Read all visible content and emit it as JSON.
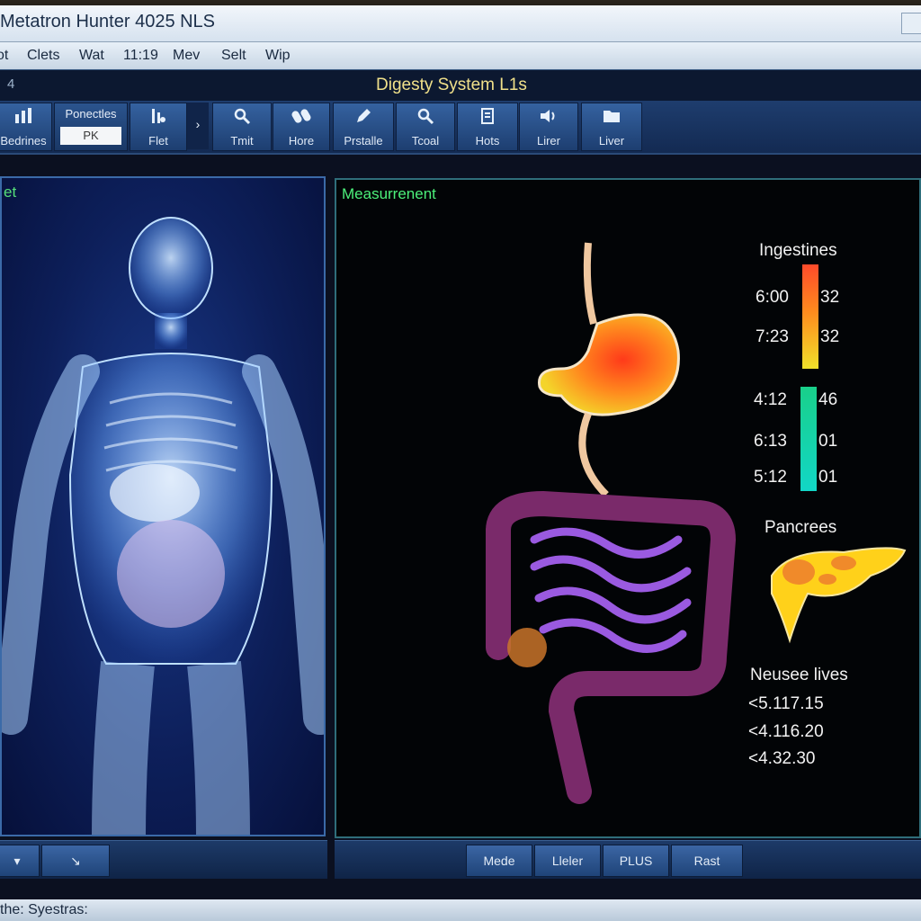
{
  "window": {
    "title": "Metatron Hunter 4025 NLS"
  },
  "menu": [
    "ot",
    "Clets",
    "Wat",
    "11:19",
    "Mev",
    "Selt",
    "Wip"
  ],
  "status": {
    "left": "4",
    "center": "Digesty System L1s"
  },
  "toolbar": {
    "left_tool": {
      "icon": "chart-icon",
      "label": "Bedrines"
    },
    "combo": {
      "label": "Ponectles",
      "value": "PK"
    },
    "tools": [
      {
        "icon": "filter-icon",
        "label": "Flet"
      },
      {
        "icon": "search-gear-icon",
        "label": "Tmit"
      },
      {
        "icon": "pills-icon",
        "label": "Hore"
      },
      {
        "icon": "pencil-icon",
        "label": "Prstalle"
      },
      {
        "icon": "search-icon",
        "label": "Tcoal"
      },
      {
        "icon": "document-icon",
        "label": "Hots"
      },
      {
        "icon": "speaker-icon",
        "label": "Lirer"
      },
      {
        "icon": "folder-icon",
        "label": "Liver"
      }
    ]
  },
  "left_panel": {
    "label": "et"
  },
  "right_panel": {
    "label": "Measurrenent",
    "legend1": {
      "title": "Ingestines",
      "rows": [
        {
          "time": "6:00",
          "value": "32"
        },
        {
          "time": "7:23",
          "value": "32"
        }
      ]
    },
    "legend2": {
      "rows": [
        {
          "time": "4:12",
          "value": "46"
        },
        {
          "time": "6:13",
          "value": "01"
        },
        {
          "time": "5:12",
          "value": "01"
        }
      ]
    },
    "organ_label": "Pancrees",
    "values_title": "Neusee lives",
    "values": [
      "<5.117.15",
      "<4.116.20",
      "<4.32.30"
    ]
  },
  "bottom_left": {
    "buttons": [
      "▾"
    ]
  },
  "bottom_buttons": [
    "Mede",
    "Lleler",
    "PLUS",
    "Rast"
  ],
  "footer": "the: Syestras:",
  "colors": {
    "heat_high": "#ff4a2a",
    "heat_mid": "#ff8a1e",
    "heat_low": "#f0e02a",
    "cool": "#12d6c6",
    "label_green": "#4cf07a",
    "header_yellow": "#f0e08a"
  }
}
